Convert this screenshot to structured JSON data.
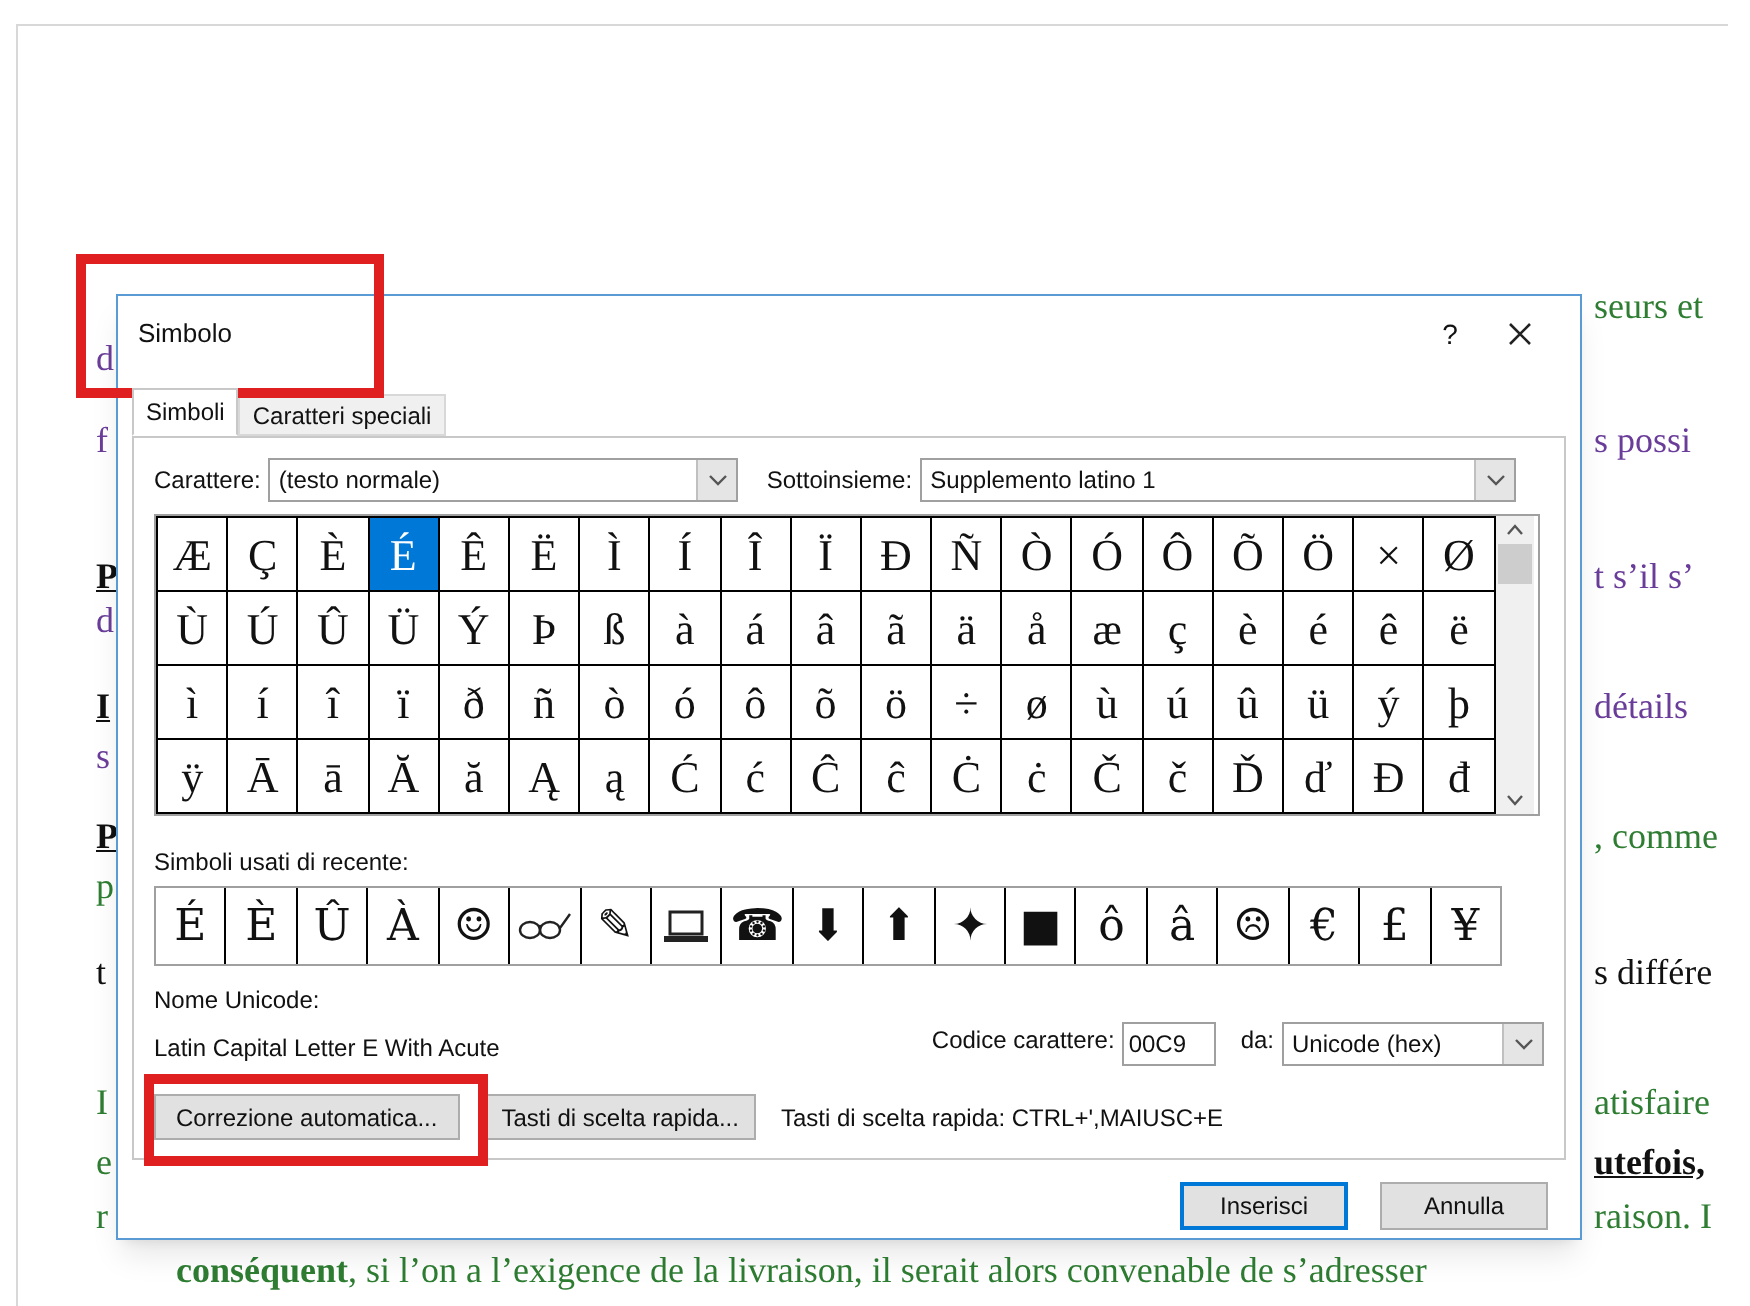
{
  "document": {
    "lines": [
      {
        "right": {
          "text": "seurs et",
          "color": "#2e7d32",
          "bold": false
        }
      },
      {
        "left": {
          "text": "d",
          "color": "#6a3d9a",
          "bold": false
        }
      },
      {
        "left": {
          "text": "f",
          "color": "#6a3d9a",
          "bold": false
        },
        "right": {
          "text": "s possi",
          "color": "#6a3d9a",
          "bold": false
        }
      },
      {
        "left": {
          "text": "P",
          "color": "#111111",
          "bold": true
        },
        "right": {
          "text": "t s’il s’",
          "color": "#6a3d9a",
          "bold": false
        }
      },
      {
        "left": {
          "text": "d",
          "color": "#6a3d9a",
          "bold": false
        }
      },
      {
        "left": {
          "text": "I",
          "color": "#111111",
          "bold": true
        },
        "right": {
          "text": "détails",
          "color": "#6a3d9a",
          "bold": false
        }
      },
      {
        "left": {
          "text": "s",
          "color": "#6a3d9a",
          "bold": false
        }
      },
      {
        "left": {
          "text": "P",
          "color": "#111111",
          "bold": true
        },
        "right": {
          "text": ", comme",
          "color": "#2e7d32",
          "bold": false
        }
      },
      {
        "left": {
          "text": "p",
          "color": "#2e7d32",
          "bold": false
        }
      },
      {
        "left": {
          "text": "t",
          "color": "#111111",
          "bold": false
        },
        "right": {
          "text": "s différe",
          "color": "#111111",
          "bold": false
        }
      },
      {
        "left": {
          "text": "I",
          "color": "#2e7d32",
          "bold": false
        },
        "right": {
          "text": "atisfaire",
          "color": "#2e7d32",
          "bold": false
        }
      },
      {
        "left": {
          "text": "e",
          "color": "#2e7d32",
          "bold": false
        },
        "right": {
          "text": "utefois,",
          "color": "#111111",
          "bold": true
        }
      },
      {
        "left": {
          "text": "r",
          "color": "#2e7d32",
          "bold": false
        },
        "right": {
          "text": "raison. I",
          "color": "#2e7d32",
          "bold": false
        }
      }
    ],
    "last_line": "**conséquent**, si l’on a l’exigence de la livraison, il serait alors convenable de s’adresser"
  },
  "dialog": {
    "title": "Simbolo",
    "help": "?",
    "tabs": [
      {
        "label": "Simboli",
        "selected": true
      },
      {
        "label": "Caratteri speciali",
        "selected": false
      }
    ],
    "font_label": "Carattere:",
    "font_value": "(testo normale)",
    "subset_label": "Sottoinsieme:",
    "subset_value": "Supplemento latino 1",
    "grid": [
      [
        {
          "char": "Æ",
          "selected": false
        },
        {
          "char": "Ç",
          "selected": false
        },
        {
          "char": "È",
          "selected": false
        },
        {
          "char": "É",
          "selected": true
        },
        {
          "char": "Ê",
          "selected": false
        },
        {
          "char": "Ë",
          "selected": false
        },
        {
          "char": "Ì",
          "selected": false
        },
        {
          "char": "Í",
          "selected": false
        },
        {
          "char": "Î",
          "selected": false
        },
        {
          "char": "Ï",
          "selected": false
        },
        {
          "char": "Ð",
          "selected": false
        },
        {
          "char": "Ñ",
          "selected": false
        },
        {
          "char": "Ò",
          "selected": false
        },
        {
          "char": "Ó",
          "selected": false
        },
        {
          "char": "Ô",
          "selected": false
        },
        {
          "char": "Õ",
          "selected": false
        },
        {
          "char": "Ö",
          "selected": false
        },
        {
          "char": "×",
          "selected": false
        },
        {
          "char": "Ø",
          "selected": false
        }
      ],
      [
        {
          "char": "Ù",
          "selected": false
        },
        {
          "char": "Ú",
          "selected": false
        },
        {
          "char": "Û",
          "selected": false
        },
        {
          "char": "Ü",
          "selected": false
        },
        {
          "char": "Ý",
          "selected": false
        },
        {
          "char": "Þ",
          "selected": false
        },
        {
          "char": "ß",
          "selected": false
        },
        {
          "char": "à",
          "selected": false
        },
        {
          "char": "á",
          "selected": false
        },
        {
          "char": "â",
          "selected": false
        },
        {
          "char": "ã",
          "selected": false
        },
        {
          "char": "ä",
          "selected": false
        },
        {
          "char": "å",
          "selected": false
        },
        {
          "char": "æ",
          "selected": false
        },
        {
          "char": "ç",
          "selected": false
        },
        {
          "char": "è",
          "selected": false
        },
        {
          "char": "é",
          "selected": false
        },
        {
          "char": "ê",
          "selected": false
        },
        {
          "char": "ë",
          "selected": false
        }
      ],
      [
        {
          "char": "ì",
          "selected": false
        },
        {
          "char": "í",
          "selected": false
        },
        {
          "char": "î",
          "selected": false
        },
        {
          "char": "ï",
          "selected": false
        },
        {
          "char": "ð",
          "selected": false
        },
        {
          "char": "ñ",
          "selected": false
        },
        {
          "char": "ò",
          "selected": false
        },
        {
          "char": "ó",
          "selected": false
        },
        {
          "char": "ô",
          "selected": false
        },
        {
          "char": "õ",
          "selected": false
        },
        {
          "char": "ö",
          "selected": false
        },
        {
          "char": "÷",
          "selected": false
        },
        {
          "char": "ø",
          "selected": false
        },
        {
          "char": "ù",
          "selected": false
        },
        {
          "char": "ú",
          "selected": false
        },
        {
          "char": "û",
          "selected": false
        },
        {
          "char": "ü",
          "selected": false
        },
        {
          "char": "ý",
          "selected": false
        },
        {
          "char": "þ",
          "selected": false
        }
      ],
      [
        {
          "char": "ÿ",
          "selected": false
        },
        {
          "char": "Ā",
          "selected": false
        },
        {
          "char": "ā",
          "selected": false
        },
        {
          "char": "Ă",
          "selected": false
        },
        {
          "char": "ă",
          "selected": false
        },
        {
          "char": "Ą",
          "selected": false
        },
        {
          "char": "ą",
          "selected": false
        },
        {
          "char": "Ć",
          "selected": false
        },
        {
          "char": "ć",
          "selected": false
        },
        {
          "char": "Ĉ",
          "selected": false
        },
        {
          "char": "ĉ",
          "selected": false
        },
        {
          "char": "Ċ",
          "selected": false
        },
        {
          "char": "ċ",
          "selected": false
        },
        {
          "char": "Č",
          "selected": false
        },
        {
          "char": "č",
          "selected": false
        },
        {
          "char": "Ď",
          "selected": false
        },
        {
          "char": "ď",
          "selected": false
        },
        {
          "char": "Đ",
          "selected": false
        },
        {
          "char": "đ",
          "selected": false
        }
      ]
    ],
    "recent_label": "Simboli usati di recente:",
    "recent": [
      {
        "kind": "char",
        "char": "É"
      },
      {
        "kind": "char",
        "char": "È"
      },
      {
        "kind": "char",
        "char": "Û"
      },
      {
        "kind": "char",
        "char": "À"
      },
      {
        "kind": "char",
        "char": "☺"
      },
      {
        "kind": "glasses"
      },
      {
        "kind": "char",
        "char": "✎"
      },
      {
        "kind": "laptop"
      },
      {
        "kind": "char",
        "char": "☎"
      },
      {
        "kind": "char",
        "char": "⬇"
      },
      {
        "kind": "char",
        "char": "⬆"
      },
      {
        "kind": "char",
        "char": "✦"
      },
      {
        "kind": "char",
        "char": "■"
      },
      {
        "kind": "char",
        "char": "ô"
      },
      {
        "kind": "char",
        "char": "â"
      },
      {
        "kind": "char",
        "char": "☹"
      },
      {
        "kind": "char",
        "char": "€"
      },
      {
        "kind": "char",
        "char": "£"
      },
      {
        "kind": "char",
        "char": "¥"
      }
    ],
    "unicode_name_label": "Nome Unicode:",
    "unicode_name": "Latin Capital Letter E With Acute",
    "code_label": "Codice carattere:",
    "code_value": "00C9",
    "from_label": "da:",
    "from_value": "Unicode (hex)",
    "autocorrect_button": "Correzione automatica...",
    "shortcut_button": "Tasti di scelta rapida...",
    "shortcut_text": "Tasti di scelta rapida: CTRL+',MAIUSC+E",
    "insert_button": "Inserisci",
    "cancel_button": "Annulla"
  }
}
